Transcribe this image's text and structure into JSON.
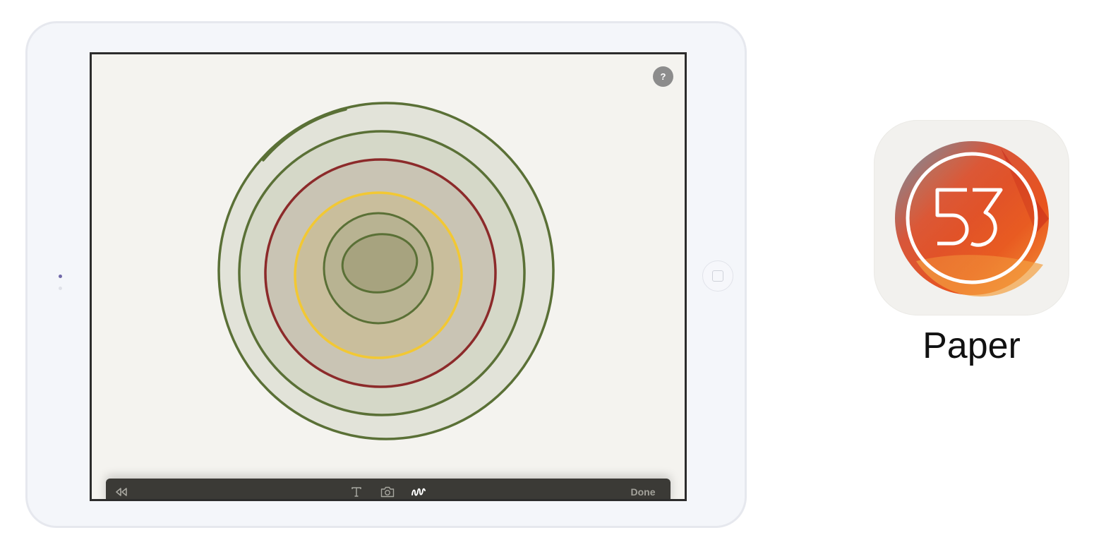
{
  "help": {
    "label": "?"
  },
  "toolbar": {
    "rewind_icon": "rewind-icon",
    "text_icon": "text-tool-icon",
    "camera_icon": "camera-icon",
    "draw_icon": "draw-squiggle-icon",
    "done_label": "Done"
  },
  "app": {
    "name": "Paper",
    "icon_text": "53",
    "icon_name": "paper-53-app-icon"
  },
  "colors": {
    "stroke_green": "#5a7036",
    "stroke_red": "#8c2a2a",
    "stroke_yellow": "#f2c833",
    "canvas": "#f4f3ef",
    "toolbar": "#3b3a36",
    "icon_orange": "#e85a1e"
  }
}
